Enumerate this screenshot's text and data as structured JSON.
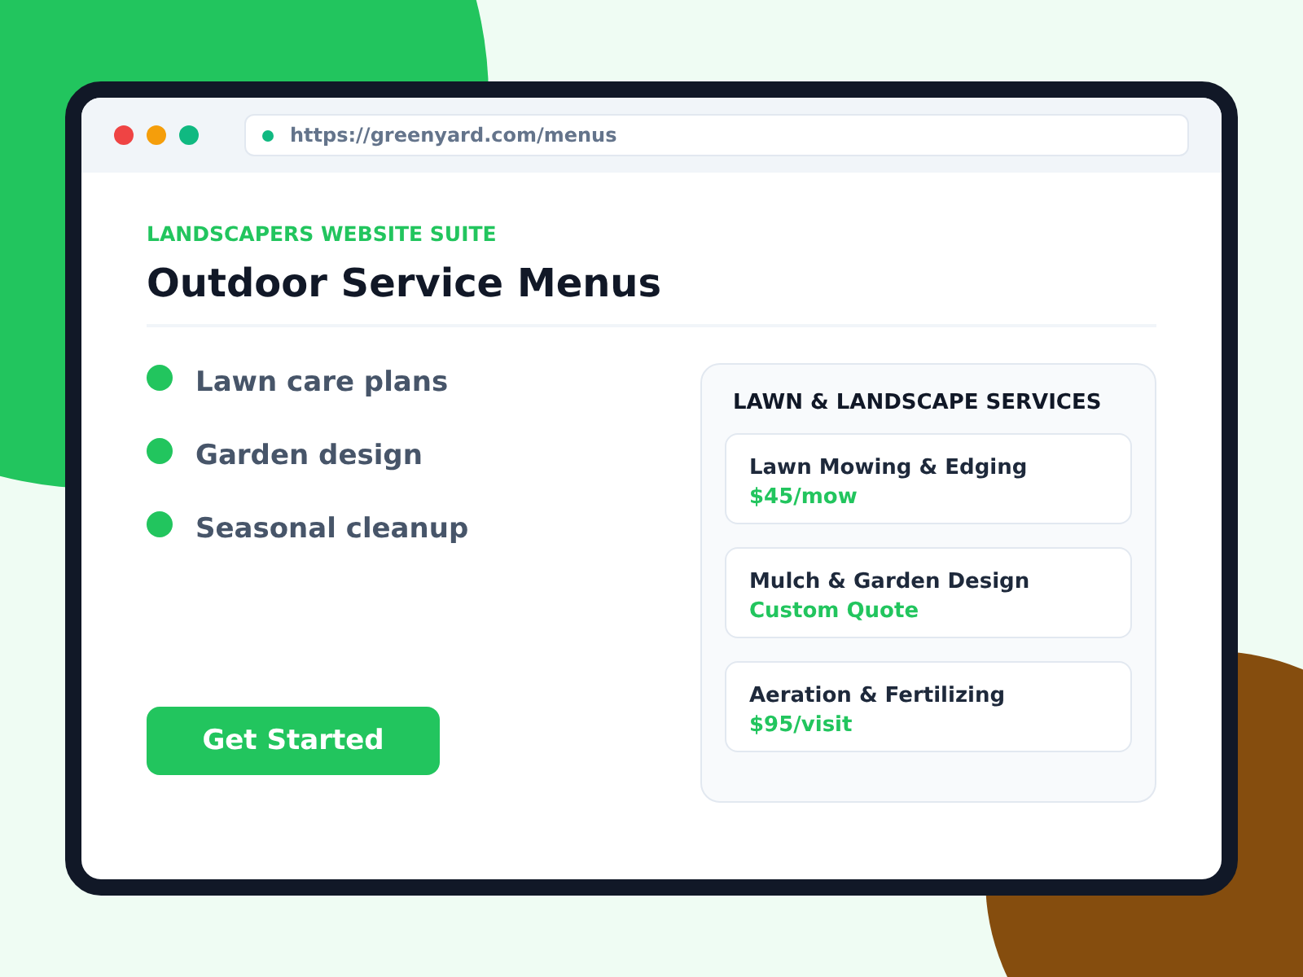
{
  "browser": {
    "window_controls": [
      {
        "color": "#ef4444"
      },
      {
        "color": "#f59e0b"
      },
      {
        "color": "#10b981"
      }
    ],
    "url": "https://greenyard.com/menus"
  },
  "hero": {
    "eyebrow": "LANDSCAPERS WEBSITE SUITE",
    "title": "Outdoor Service Menus",
    "features": [
      "Lawn care plans",
      "Garden design",
      "Seasonal cleanup"
    ],
    "cta": "Get Started"
  },
  "panel": {
    "heading": "LAWN & LANDSCAPE SERVICES",
    "services": [
      {
        "name": "Lawn Mowing & Edging",
        "price": "$45/mow"
      },
      {
        "name": "Mulch & Garden Design",
        "price": "Custom Quote"
      },
      {
        "name": "Aeration & Fertilizing",
        "price": "$95/visit"
      }
    ]
  }
}
